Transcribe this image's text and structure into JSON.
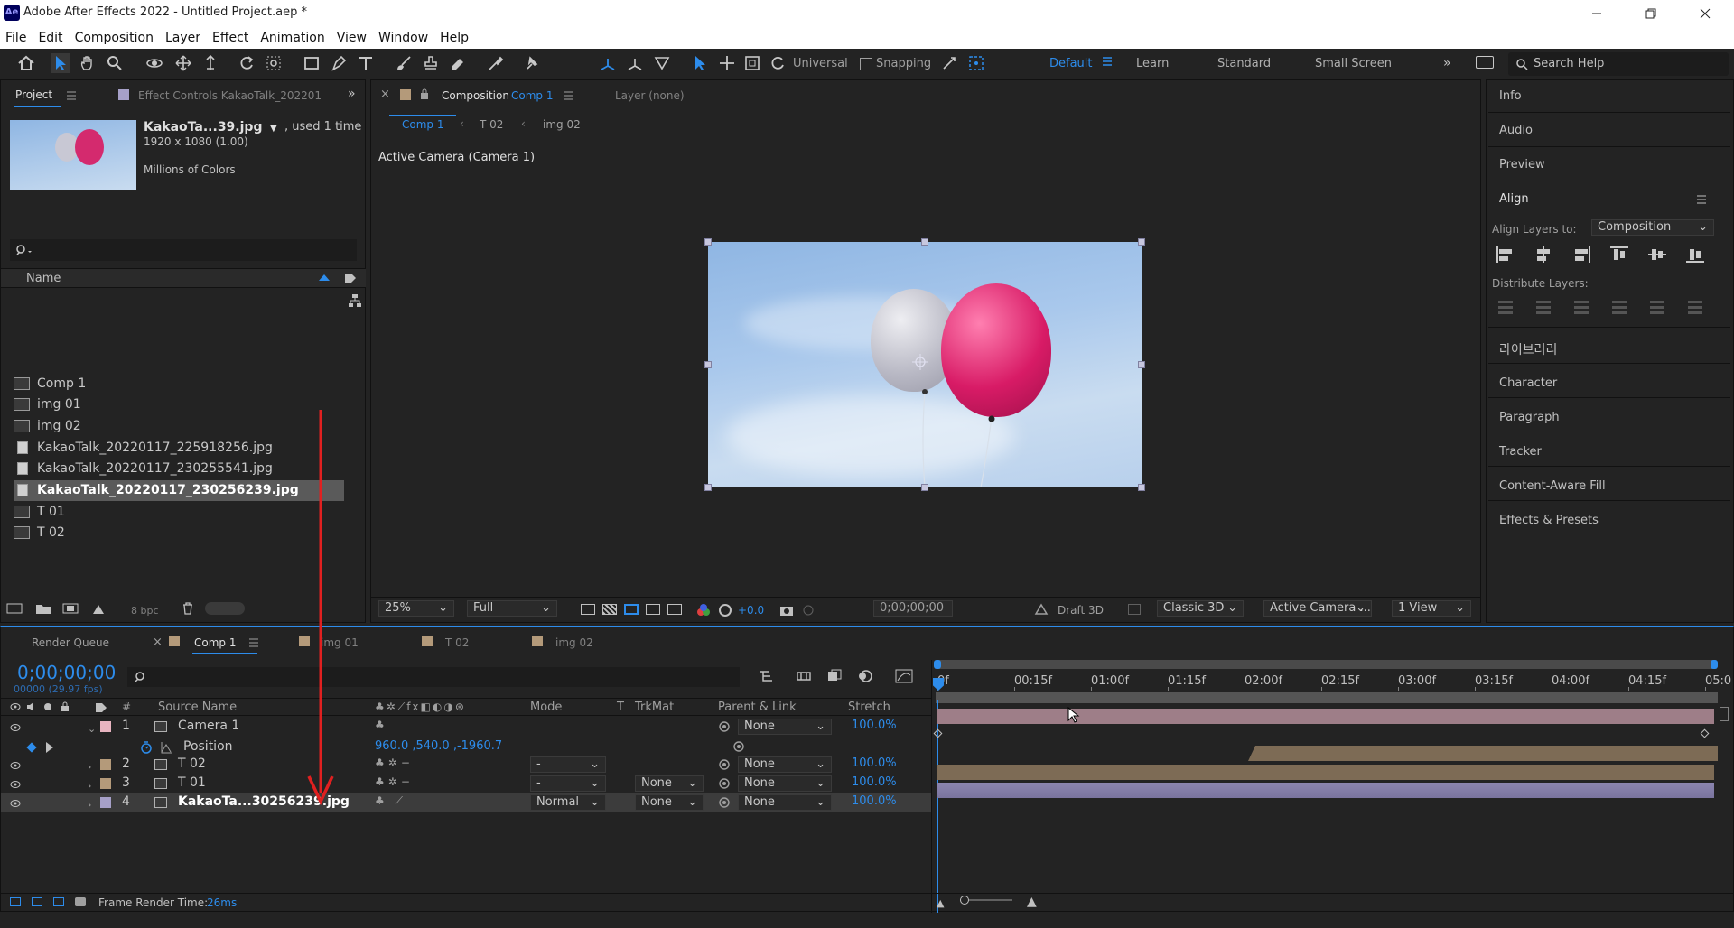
{
  "window": {
    "title": "Adobe After Effects 2022 - Untitled Project.aep *",
    "app_badge": "Ae"
  },
  "menu": [
    "File",
    "Edit",
    "Composition",
    "Layer",
    "Effect",
    "Animation",
    "View",
    "Window",
    "Help"
  ],
  "toolbar": {
    "axis_mode": "Universal",
    "snapping": "Snapping"
  },
  "workspaces": {
    "default": "Default",
    "learn": "Learn",
    "standard": "Standard",
    "small_screen": "Small Screen",
    "search_placeholder": "Search Help"
  },
  "project_panel": {
    "tab_project": "Project",
    "tab_effect_controls": "Effect Controls KakaoTalk_202201",
    "preview_name": "KakaoTa...39.jpg",
    "preview_used": ", used 1 time",
    "preview_dims": "1920 x 1080 (1.00)",
    "preview_colors": "Millions of Colors",
    "column_name": "Name",
    "items": [
      {
        "name": "Comp 1",
        "type": "comp"
      },
      {
        "name": "img 01",
        "type": "comp"
      },
      {
        "name": "img 02",
        "type": "comp"
      },
      {
        "name": "KakaoTalk_20220117_225918256.jpg",
        "type": "image"
      },
      {
        "name": "KakaoTalk_20220117_230255541.jpg",
        "type": "image"
      },
      {
        "name": "KakaoTalk_20220117_230256239.jpg",
        "type": "image",
        "selected": true
      },
      {
        "name": "T 01",
        "type": "comp"
      },
      {
        "name": "T 02",
        "type": "comp"
      }
    ],
    "bpc": "8 bpc"
  },
  "composition_panel": {
    "tab_label": "Composition",
    "tab_comp": "Comp 1",
    "layer_tab": "Layer (none)",
    "breadcrumbs": [
      "Comp 1",
      "T 02",
      "img 02"
    ],
    "camera_label": "Active Camera (Camera 1)",
    "zoom": "25%",
    "resolution": "Full",
    "exposure": "+0.0",
    "timecode": "0;00;00;00",
    "draft3d": "Draft 3D",
    "renderer": "Classic 3D",
    "camera_select": "Active Camera ...",
    "views": "1 View"
  },
  "right_panel": {
    "items_top": [
      "Info",
      "Audio",
      "Preview"
    ],
    "align_title": "Align",
    "align_layers_to_label": "Align Layers to:",
    "align_layers_to_value": "Composition",
    "distribute_label": "Distribute Layers:",
    "items_bottom": [
      "라이브러리",
      "Character",
      "Paragraph",
      "Tracker",
      "Content-Aware Fill",
      "Effects & Presets"
    ]
  },
  "timeline": {
    "tabs": [
      "Render Queue",
      "Comp 1",
      "img 01",
      "T 02",
      "img 02"
    ],
    "timecode": "0;00;00;00",
    "fps": "00000 (29.97 fps)",
    "headers": {
      "num": "#",
      "source": "Source Name",
      "mode": "Mode",
      "t": "T",
      "trkmat": "TrkMat",
      "parent": "Parent & Link",
      "stretch": "Stretch"
    },
    "ruler": [
      "0f",
      "00:15f",
      "01:00f",
      "01:15f",
      "02:00f",
      "02:15f",
      "03:00f",
      "03:15f",
      "04:00f",
      "04:15f",
      "05:0"
    ],
    "layers": [
      {
        "num": "1",
        "name": "Camera 1",
        "mode": "",
        "trkmat": "",
        "parent": "None",
        "stretch": "100.0%",
        "color": "#e8b4c0"
      },
      {
        "num": "2",
        "name": "T 02",
        "mode": "-",
        "trkmat": "",
        "parent": "None",
        "stretch": "100.0%",
        "color": "#b49a7a"
      },
      {
        "num": "3",
        "name": "T 01",
        "mode": "-",
        "trkmat": "None",
        "parent": "None",
        "stretch": "100.0%",
        "color": "#b49a7a"
      },
      {
        "num": "4",
        "name": "KakaoTa...30256239.jpg",
        "mode": "Normal",
        "trkmat": "None",
        "parent": "None",
        "stretch": "100.0%",
        "color": "#a6a0c8"
      }
    ],
    "position_label": "Position",
    "position_value": "960.0 ,540.0 ,-1960.7",
    "frame_render_label": "Frame Render Time:",
    "frame_render_value": "26ms"
  }
}
